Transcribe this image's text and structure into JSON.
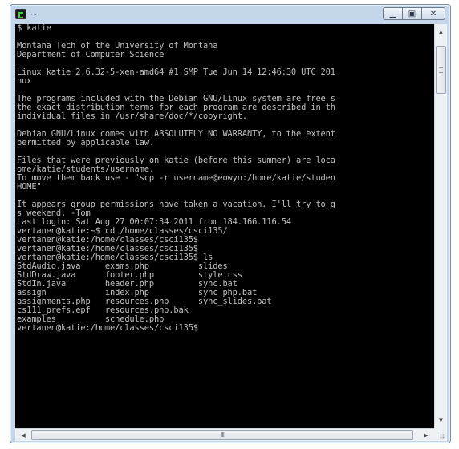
{
  "window": {
    "title": "~",
    "minimize_label": "▁",
    "maximize_label": "▣",
    "close_label": "✕"
  },
  "terminal": {
    "lines": [
      "$ katie",
      "",
      "Montana Tech of the University of Montana",
      "Department of Computer Science",
      "",
      "Linux katie 2.6.32-5-xen-amd64 #1 SMP Tue Jun 14 12:46:30 UTC 201",
      "nux",
      "",
      "The programs included with the Debian GNU/Linux system are free s",
      "the exact distribution terms for each program are described in th",
      "individual files in /usr/share/doc/*/copyright.",
      "",
      "Debian GNU/Linux comes with ABSOLUTELY NO WARRANTY, to the extent",
      "permitted by applicable law.",
      "",
      "Files that were previously on katie (before this summer) are loca",
      "ome/katie/students/username.",
      "To move them back use - \"scp -r username@eowyn:/home/katie/studen",
      "HOME\"",
      "",
      "It appears group permissions have taken a vacation. I'll try to g",
      "s weekend. -Tom",
      "Last login: Sat Aug 27 00:07:34 2011 from 184.166.116.54",
      "vertanen@katie:~$ cd /home/classes/csci135/",
      "vertanen@katie:/home/classes/csci135$",
      "vertanen@katie:/home/classes/csci135$",
      "vertanen@katie:/home/classes/csci135$ ls",
      "StdAudio.java     exams.php          slides",
      "StdDraw.java      footer.php         style.css",
      "StdIn.java        header.php         sync.bat",
      "assign            index.php          sync_php.bat",
      "assignments.php   resources.php      sync_slides.bat",
      "cs111_prefs.epf   resources.php.bak",
      "examples          schedule.php",
      "vertanen@katie:/home/classes/csci135$"
    ]
  },
  "scrollbars": {
    "up_arrow": "▲",
    "down_arrow": "▼",
    "left_arrow": "◀",
    "right_arrow": "▶",
    "h_thumb_grip": "III"
  }
}
